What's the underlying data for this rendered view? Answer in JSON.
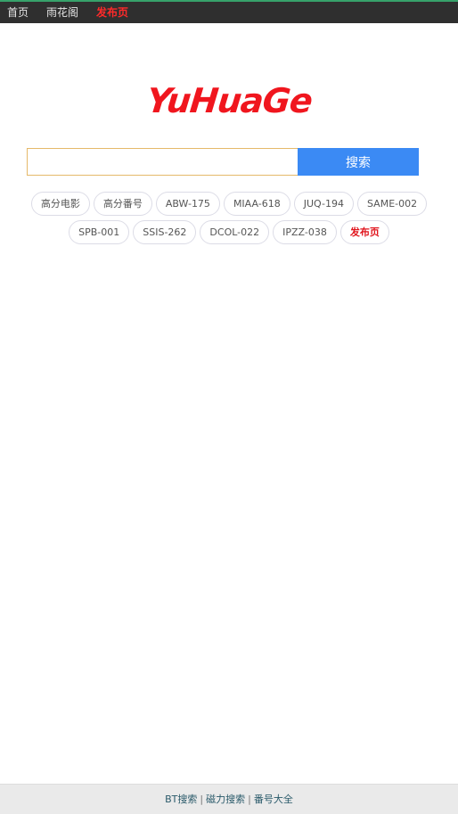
{
  "nav": {
    "items": [
      {
        "label": "首页"
      },
      {
        "label": "雨花阁"
      },
      {
        "label": "发布页"
      }
    ]
  },
  "logo": {
    "text": "YuHuaGe"
  },
  "search": {
    "value": "",
    "placeholder": "",
    "button_label": "搜索"
  },
  "tags": [
    {
      "label": "高分电影"
    },
    {
      "label": "高分番号"
    },
    {
      "label": "ABW-175"
    },
    {
      "label": "MIAA-618"
    },
    {
      "label": "JUQ-194"
    },
    {
      "label": "SAME-002"
    },
    {
      "label": "SPB-001"
    },
    {
      "label": "SSIS-262"
    },
    {
      "label": "DCOL-022"
    },
    {
      "label": "IPZZ-038"
    },
    {
      "label": "发布页"
    }
  ],
  "footer": {
    "links": [
      {
        "label": "BT搜索"
      },
      {
        "label": "磁力搜索"
      },
      {
        "label": "番号大全"
      }
    ],
    "separator": "|"
  },
  "colors": {
    "accent": "#3b8af4",
    "brand": "#f0161e",
    "topbar": "#2f2f2f"
  }
}
